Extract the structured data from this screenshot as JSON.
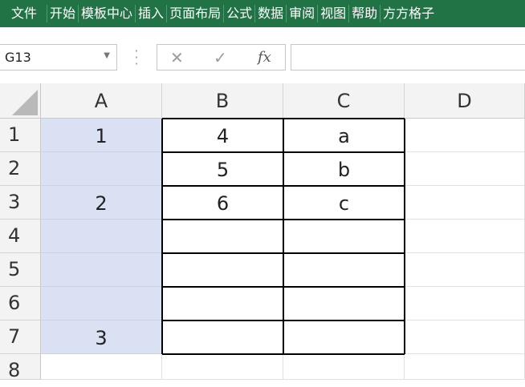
{
  "ribbon": {
    "tabs": [
      "文件",
      "开始",
      "模板中心",
      "插入",
      "页面布局",
      "公式",
      "数据",
      "审阅",
      "视图",
      "帮助",
      "方方格子"
    ]
  },
  "name_box": {
    "value": "G13"
  },
  "formula_bar": {
    "cancel_icon": "x-icon",
    "enter_icon": "check-icon",
    "function_label": "fx",
    "value": ""
  },
  "sheet": {
    "columns": [
      "A",
      "B",
      "C",
      "D"
    ],
    "rows": [
      "1",
      "2",
      "3",
      "4",
      "5",
      "6",
      "7",
      "8"
    ],
    "cells": {
      "A1": "1",
      "B1": "4",
      "C1": "a",
      "A2": "",
      "B2": "5",
      "C2": "b",
      "A3": "2",
      "B3": "6",
      "C3": "c",
      "A7": "3"
    },
    "selected_range": "A1:A7",
    "selection_color": "#d9e1f2"
  },
  "colors": {
    "ribbon_bg": "#217346",
    "header_bg": "#f3f3f3"
  }
}
